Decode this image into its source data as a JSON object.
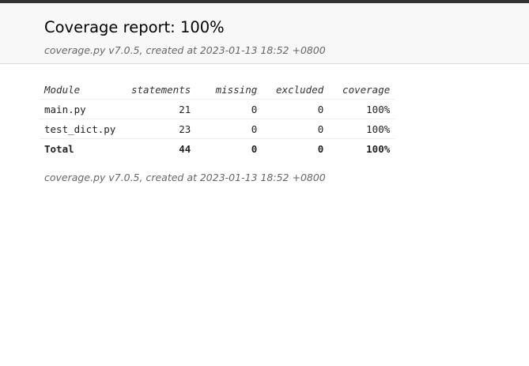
{
  "title": "Coverage report: 100%",
  "created_line": "coverage.py v7.0.5, created at 2023-01-13 18:52 +0800",
  "table": {
    "headers": [
      "Module",
      "statements",
      "missing",
      "excluded",
      "coverage"
    ],
    "rows": [
      {
        "module": "main.py",
        "statements": "21",
        "missing": "0",
        "excluded": "0",
        "coverage": "100%"
      },
      {
        "module": "test_dict.py",
        "statements": "23",
        "missing": "0",
        "excluded": "0",
        "coverage": "100%"
      }
    ],
    "total": {
      "module": "Total",
      "statements": "44",
      "missing": "0",
      "excluded": "0",
      "coverage": "100%"
    }
  },
  "footer_line": "coverage.py v7.0.5, created at 2023-01-13 18:52 +0800"
}
